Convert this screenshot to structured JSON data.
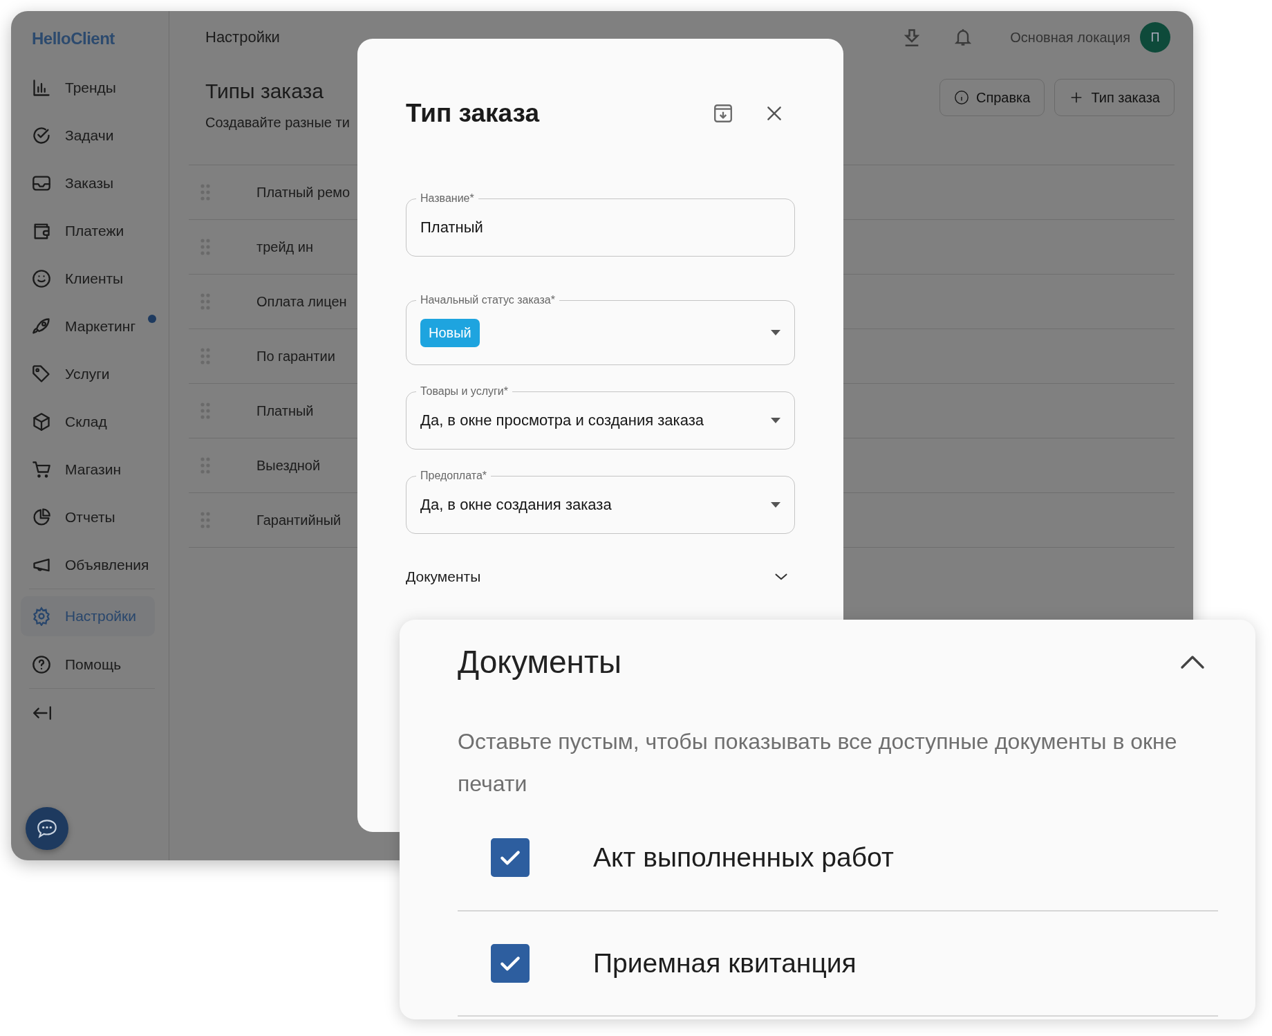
{
  "app": {
    "logo": "HelloClient"
  },
  "sidebar": {
    "main_items": [
      {
        "label": "Тренды",
        "selected": false,
        "dot": false
      },
      {
        "label": "Задачи",
        "selected": false,
        "dot": false
      },
      {
        "label": "Заказы",
        "selected": false,
        "dot": false
      },
      {
        "label": "Платежи",
        "selected": false,
        "dot": false
      },
      {
        "label": "Клиенты",
        "selected": false,
        "dot": false
      },
      {
        "label": "Маркетинг",
        "selected": false,
        "dot": true
      },
      {
        "label": "Услуги",
        "selected": false,
        "dot": false
      },
      {
        "label": "Склад",
        "selected": false,
        "dot": false
      },
      {
        "label": "Магазин",
        "selected": false,
        "dot": false
      },
      {
        "label": "Отчеты",
        "selected": false,
        "dot": false
      },
      {
        "label": "Объявления",
        "selected": false,
        "dot": false
      }
    ],
    "bottom_items": [
      {
        "label": "Настройки",
        "selected": true,
        "dot": false
      },
      {
        "label": "Помощь",
        "selected": false,
        "dot": false
      }
    ]
  },
  "header": {
    "title": "Настройки",
    "location": "Основная локация",
    "avatar": "П"
  },
  "page": {
    "title": "Типы заказа",
    "subtitle": "Создавайте разные ти",
    "buttons": [
      "Справка",
      "Тип заказа"
    ]
  },
  "rows": [
    "Платный ремо",
    "трейд ин",
    "Оплата лицен",
    "По гарантии",
    "Платный",
    "Выездной",
    "Гарантийный"
  ],
  "modal": {
    "title": "Тип заказа",
    "fields": [
      {
        "kind": "text",
        "label": "Название*",
        "value": "Платный"
      },
      {
        "kind": "status",
        "label": "Начальный статус заказа*",
        "value": "Новый"
      },
      {
        "kind": "select",
        "label": "Товары и услуги*",
        "value": "Да, в окне просмотра и создания заказа"
      },
      {
        "kind": "select",
        "label": "Предоплата*",
        "value": "Да, в окне создания заказа"
      }
    ],
    "section": {
      "title": "Документы",
      "expanded": false
    }
  },
  "documents_panel": {
    "title": "Документы",
    "expanded": true,
    "hint": "Оставьте пустым, чтобы показывать все доступные документы в окне печати",
    "documents": [
      {
        "label": "Акт выполненных работ",
        "checked": true
      },
      {
        "label": "Приемная квитанция",
        "checked": true
      }
    ]
  }
}
